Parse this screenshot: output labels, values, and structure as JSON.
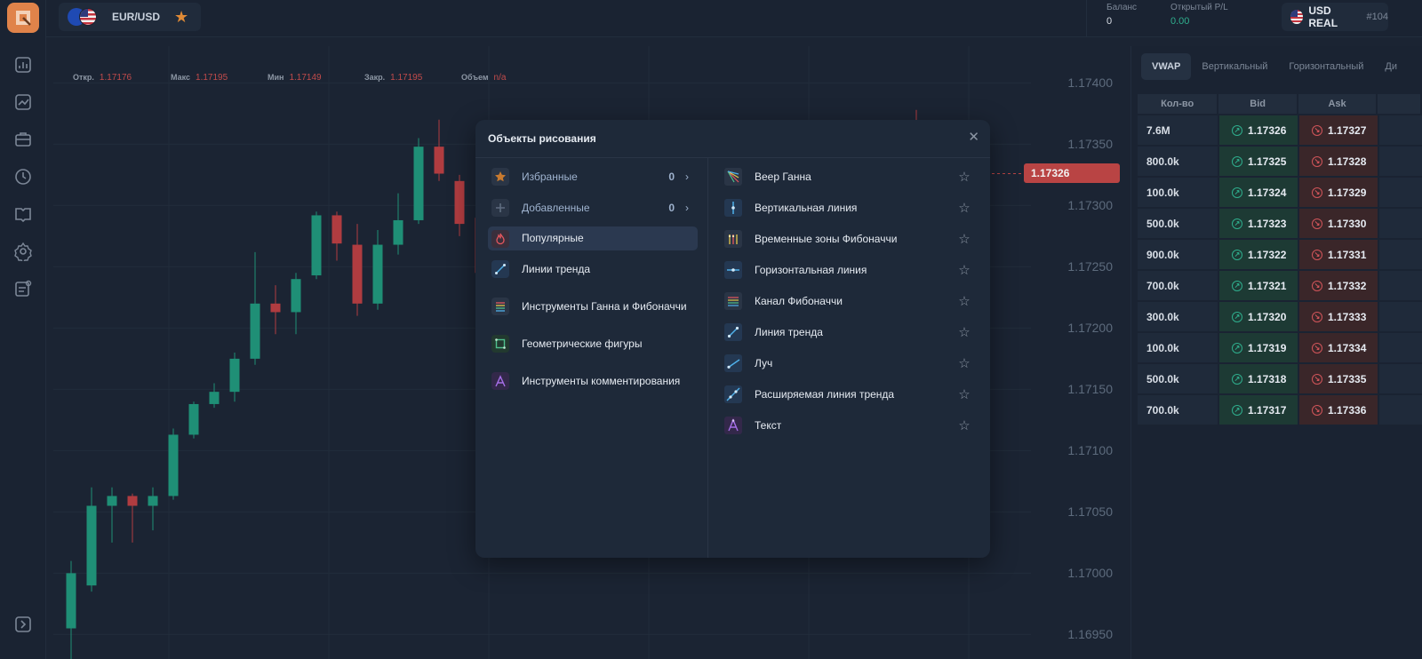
{
  "header": {
    "asset_name": "EUR/USD",
    "balance_label": "Баланс",
    "balance_value": "0",
    "pl_label": "Открытый P/L",
    "pl_value": "0.00",
    "currency": "USD REAL",
    "account_id": "#104"
  },
  "ohlc": {
    "open_label": "Откр.",
    "open_value": "1.17176",
    "high_label": "Макс",
    "high_value": "1.17195",
    "low_label": "Мин",
    "low_value": "1.17149",
    "close_label": "Закр.",
    "close_value": "1.17195",
    "volume_label": "Объем",
    "volume_value": "n/a"
  },
  "chart_data": {
    "type": "candlestick",
    "y_ticks": [
      "1.17400",
      "1.17350",
      "1.17300",
      "1.17250",
      "1.17200",
      "1.17150",
      "1.17100",
      "1.17050",
      "1.17000",
      "1.16950"
    ],
    "ylim": [
      1.1693,
      1.1743
    ],
    "current_price": "1.17326",
    "candles": [
      {
        "o": 1.16955,
        "c": 1.17,
        "h": 1.1701,
        "l": 1.1692,
        "dir": "up"
      },
      {
        "o": 1.1699,
        "c": 1.17055,
        "h": 1.1707,
        "l": 1.16985,
        "dir": "up"
      },
      {
        "o": 1.17055,
        "c": 1.17063,
        "h": 1.1707,
        "l": 1.17025,
        "dir": "up"
      },
      {
        "o": 1.17063,
        "c": 1.17055,
        "h": 1.17065,
        "l": 1.17025,
        "dir": "down"
      },
      {
        "o": 1.17055,
        "c": 1.17063,
        "h": 1.1707,
        "l": 1.17035,
        "dir": "up"
      },
      {
        "o": 1.17063,
        "c": 1.17113,
        "h": 1.17118,
        "l": 1.1706,
        "dir": "up"
      },
      {
        "o": 1.17113,
        "c": 1.17138,
        "h": 1.1714,
        "l": 1.1711,
        "dir": "up"
      },
      {
        "o": 1.17138,
        "c": 1.17148,
        "h": 1.17155,
        "l": 1.17135,
        "dir": "up"
      },
      {
        "o": 1.17148,
        "c": 1.17175,
        "h": 1.1718,
        "l": 1.1714,
        "dir": "up"
      },
      {
        "o": 1.17175,
        "c": 1.1722,
        "h": 1.17262,
        "l": 1.1717,
        "dir": "up"
      },
      {
        "o": 1.1722,
        "c": 1.17213,
        "h": 1.17235,
        "l": 1.17195,
        "dir": "down"
      },
      {
        "o": 1.17213,
        "c": 1.1724,
        "h": 1.17245,
        "l": 1.17195,
        "dir": "up"
      },
      {
        "o": 1.17243,
        "c": 1.17292,
        "h": 1.17295,
        "l": 1.1724,
        "dir": "up"
      },
      {
        "o": 1.17292,
        "c": 1.17269,
        "h": 1.17295,
        "l": 1.17255,
        "dir": "down"
      },
      {
        "o": 1.17268,
        "c": 1.1722,
        "h": 1.17285,
        "l": 1.1721,
        "dir": "down"
      },
      {
        "o": 1.1722,
        "c": 1.17268,
        "h": 1.1728,
        "l": 1.17215,
        "dir": "up"
      },
      {
        "o": 1.17268,
        "c": 1.17288,
        "h": 1.1731,
        "l": 1.1726,
        "dir": "up"
      },
      {
        "o": 1.17288,
        "c": 1.17348,
        "h": 1.17355,
        "l": 1.17285,
        "dir": "up"
      },
      {
        "o": 1.17348,
        "c": 1.17326,
        "h": 1.1737,
        "l": 1.1732,
        "dir": "down"
      },
      {
        "o": 1.1732,
        "c": 1.17285,
        "h": 1.17325,
        "l": 1.17275,
        "dir": "down"
      },
      {
        "o": 1.1729,
        "c": 1.17245,
        "h": 1.173,
        "l": 1.1724,
        "dir": "down"
      }
    ]
  },
  "right_panel": {
    "tabs": [
      "VWAP",
      "Вертикальный",
      "Горизонтальный",
      "Ди"
    ],
    "columns": [
      "Кол-во",
      "Bid",
      "Ask"
    ],
    "rows": [
      {
        "qty": "7.6M",
        "bid": "1.17326",
        "ask": "1.17327"
      },
      {
        "qty": "800.0k",
        "bid": "1.17325",
        "ask": "1.17328"
      },
      {
        "qty": "100.0k",
        "bid": "1.17324",
        "ask": "1.17329"
      },
      {
        "qty": "500.0k",
        "bid": "1.17323",
        "ask": "1.17330"
      },
      {
        "qty": "900.0k",
        "bid": "1.17322",
        "ask": "1.17331"
      },
      {
        "qty": "700.0k",
        "bid": "1.17321",
        "ask": "1.17332"
      },
      {
        "qty": "300.0k",
        "bid": "1.17320",
        "ask": "1.17333"
      },
      {
        "qty": "100.0k",
        "bid": "1.17319",
        "ask": "1.17334"
      },
      {
        "qty": "500.0k",
        "bid": "1.17318",
        "ask": "1.17335"
      },
      {
        "qty": "700.0k",
        "bid": "1.17317",
        "ask": "1.17336"
      }
    ]
  },
  "modal": {
    "title": "Объекты рисования",
    "categories": [
      {
        "label": "Избранные",
        "count": "0",
        "icon": "star-icon"
      },
      {
        "label": "Добавленные",
        "count": "0",
        "icon": "plus-icon"
      },
      {
        "label": "Популярные",
        "icon": "fire-icon",
        "active": true
      },
      {
        "label": "Линии тренда",
        "icon": "trend-line-icon"
      },
      {
        "label": "Инструменты Ганна и Фибоначчи",
        "icon": "gann-fib-icon"
      },
      {
        "label": "Геометрические фигуры",
        "icon": "rectangle-icon"
      },
      {
        "label": "Инструменты комментирования",
        "icon": "text-tool-icon"
      }
    ],
    "tools": [
      {
        "label": "Веер Ганна",
        "icon": "gann-fan-icon"
      },
      {
        "label": "Вертикальная линия",
        "icon": "vertical-line-icon"
      },
      {
        "label": "Временные зоны Фибоначчи",
        "icon": "fib-time-zones-icon"
      },
      {
        "label": "Горизонтальная линия",
        "icon": "horizontal-line-icon"
      },
      {
        "label": "Канал Фибоначчи",
        "icon": "fib-channel-icon"
      },
      {
        "label": "Линия тренда",
        "icon": "trend-line-icon"
      },
      {
        "label": "Луч",
        "icon": "ray-icon"
      },
      {
        "label": "Расширяемая линия тренда",
        "icon": "extended-trend-line-icon"
      },
      {
        "label": "Текст",
        "icon": "text-icon"
      }
    ]
  }
}
